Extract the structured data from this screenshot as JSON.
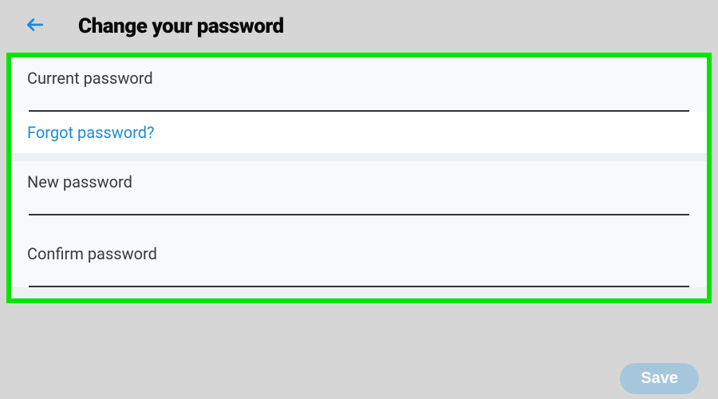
{
  "header": {
    "title": "Change your password"
  },
  "fields": {
    "current": {
      "label": "Current password",
      "value": ""
    },
    "new": {
      "label": "New password",
      "value": ""
    },
    "confirm": {
      "label": "Confirm password",
      "value": ""
    }
  },
  "links": {
    "forgot": "Forgot password?"
  },
  "buttons": {
    "save": "Save"
  }
}
